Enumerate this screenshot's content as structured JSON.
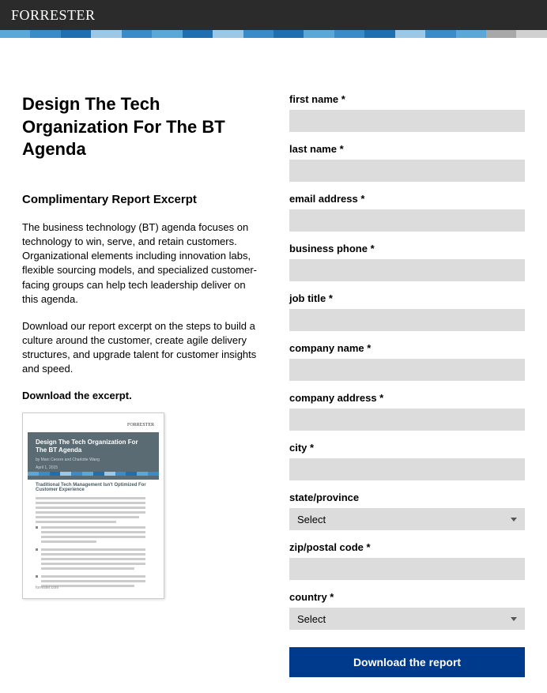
{
  "brand": "FORRESTER",
  "stripe_colors": [
    "#5aa8d8",
    "#3a8cc8",
    "#1f6fb0",
    "#9bc8e6",
    "#3a8cc8",
    "#5aa8d8",
    "#1f6fb0",
    "#9bc8e6",
    "#3a8cc8",
    "#1f6fb0",
    "#5aa8d8",
    "#3a8cc8",
    "#1f6fb0",
    "#9bc8e6",
    "#3a8cc8",
    "#5aa8d8",
    "#a8a8a8",
    "#d0d0d0"
  ],
  "headline": "Design The Tech Organization For The BT Agenda",
  "subhead": "Complimentary Report Excerpt",
  "para1": "The business technology (BT) agenda focuses on technology to win, serve, and retain customers. Organizational elements including innovation labs, flexible sourcing models, and specialized customer-facing groups can help tech leadership deliver on this agenda.",
  "para2": "Download our report excerpt on the steps to build a culture around the customer, create agile delivery structures, and upgrade talent for customer insights and speed.",
  "download_label": "Download the excerpt.",
  "thumb": {
    "brand": "FORRESTER",
    "title": "Design The Tech Organization For The BT Agenda",
    "byline": "by Marc Cecere and Charlotte Wang",
    "date": "April 1, 2015",
    "heading": "Traditional Tech Management Isn't Optimized For Customer Experience",
    "footer": "forrester.com"
  },
  "form": {
    "first_name": "first name *",
    "last_name": "last name *",
    "email": "email address *",
    "phone": "business phone *",
    "job_title": "job title *",
    "company": "company name *",
    "address": "company address *",
    "city": "city *",
    "state": "state/province",
    "state_value": "Select",
    "zip": "zip/postal code *",
    "country": "country *",
    "country_value": "Select",
    "submit": "Download the report"
  }
}
